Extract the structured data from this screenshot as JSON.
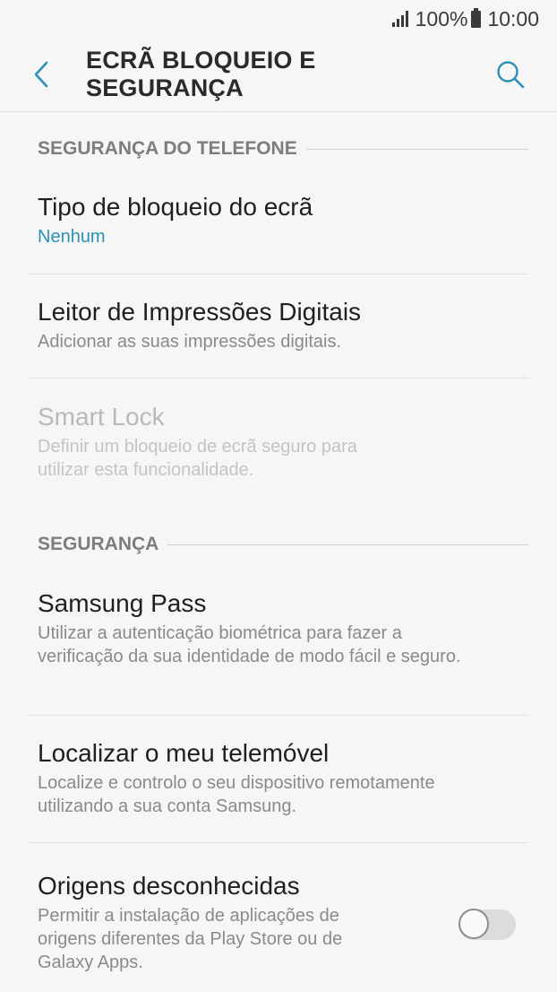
{
  "statusbar": {
    "battery": "100%",
    "time": "10:00"
  },
  "appbar": {
    "title": "ECRÃ BLOQUEIO E SEGURANÇA",
    "back_icon": "chevron-left-icon",
    "search_icon": "search-icon"
  },
  "sections": [
    {
      "header": "SEGURANÇA DO TELEFONE",
      "items": [
        {
          "title": "Tipo de bloqueio do ecrã",
          "subtitle": "Nenhum"
        },
        {
          "title": "Leitor de Impressões Digitais",
          "subtitle": "Adicionar as suas impressões digitais."
        },
        {
          "title": "Smart Lock",
          "subtitle": "Definir um bloqueio de ecrã seguro para utilizar esta funcionalidade."
        }
      ]
    },
    {
      "header": "SEGURANÇA",
      "items": [
        {
          "title": "Samsung Pass",
          "subtitle": "Utilizar a autenticação biométrica para fazer a verificação da sua identidade de modo fácil e seguro."
        },
        {
          "title": "Localizar o meu telemóvel",
          "subtitle": "Localize e controlo o seu dispositivo remotamente utilizando a sua conta Samsung."
        },
        {
          "title": "Origens desconhecidas",
          "subtitle": "Permitir a instalação de aplicações de origens diferentes da Play Store ou de Galaxy Apps.",
          "toggle_on": false
        }
      ]
    }
  ],
  "colors": {
    "accent": "#2c8fb9",
    "background": "#f6f6f6",
    "disabled_text": "#b9b9b9"
  }
}
